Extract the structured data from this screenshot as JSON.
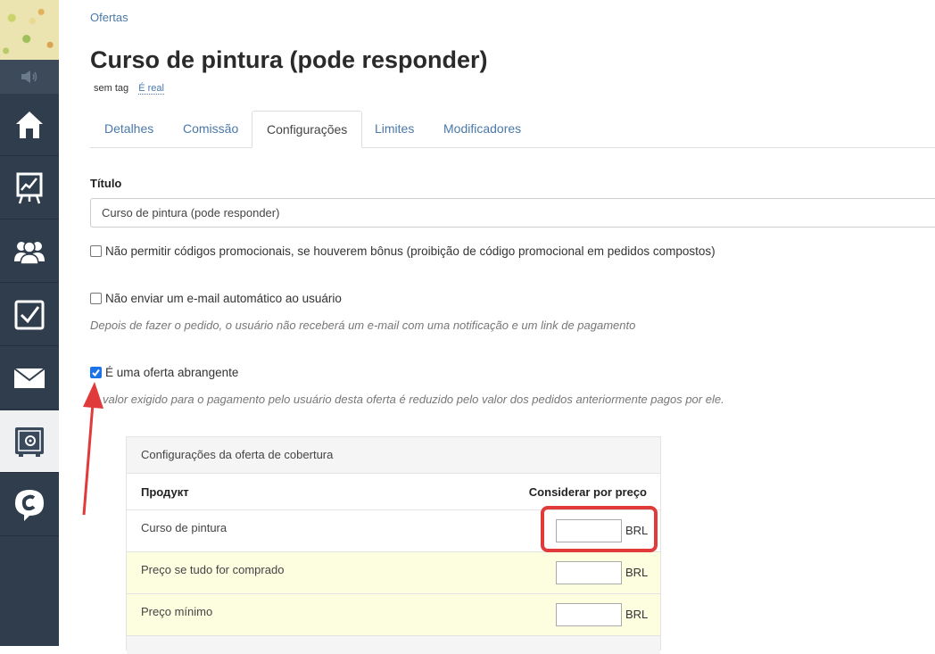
{
  "breadcrumb": "Ofertas",
  "page": {
    "title": "Curso de pintura (pode responder)"
  },
  "tags": {
    "none": "sem tag",
    "real": "É real"
  },
  "tabs": [
    {
      "label": "Detalhes"
    },
    {
      "label": "Comissão"
    },
    {
      "label": "Configurações"
    },
    {
      "label": "Limites"
    },
    {
      "label": "Modificadores"
    }
  ],
  "form": {
    "title_label": "Título",
    "title_value": "Curso de pintura (pode responder)",
    "no_promo": {
      "label": "Não permitir códigos promocionais, se houverem bônus (proibição de código promocional em pedidos compostos)",
      "checked": false
    },
    "no_email": {
      "label": "Não enviar um e-mail automático ao usuário",
      "checked": false,
      "help": "Depois de fazer o pedido, o usuário não receberá um e-mail com uma notificação e um link de pagamento"
    },
    "comprehensive": {
      "label": "É uma oferta abrangente",
      "checked": true,
      "help": "valor exigido para o pagamento pelo usuário desta oferta é reduzido pelo valor dos pedidos anteriormente pagos por ele."
    }
  },
  "coverage": {
    "heading": "Configurações da oferta de cobertura",
    "col_product": "Продукт",
    "col_price": "Considerar por preço",
    "rows": [
      {
        "name": "Curso de pintura",
        "currency": "BRL",
        "value": ""
      },
      {
        "name": "Preço se tudo for comprado",
        "currency": "BRL",
        "value": ""
      },
      {
        "name": "Preço mínimo",
        "currency": "BRL",
        "value": ""
      }
    ]
  },
  "colors": {
    "sidebar": "#2f3d4c",
    "link": "#4a78a8",
    "annotation": "#e03a3a",
    "checkbox": "#1a73e8"
  },
  "icons": [
    "speaker-icon",
    "home-icon",
    "chart-board-icon",
    "users-icon",
    "checkbox-icon",
    "mail-icon",
    "safe-icon",
    "chat-c-icon"
  ]
}
